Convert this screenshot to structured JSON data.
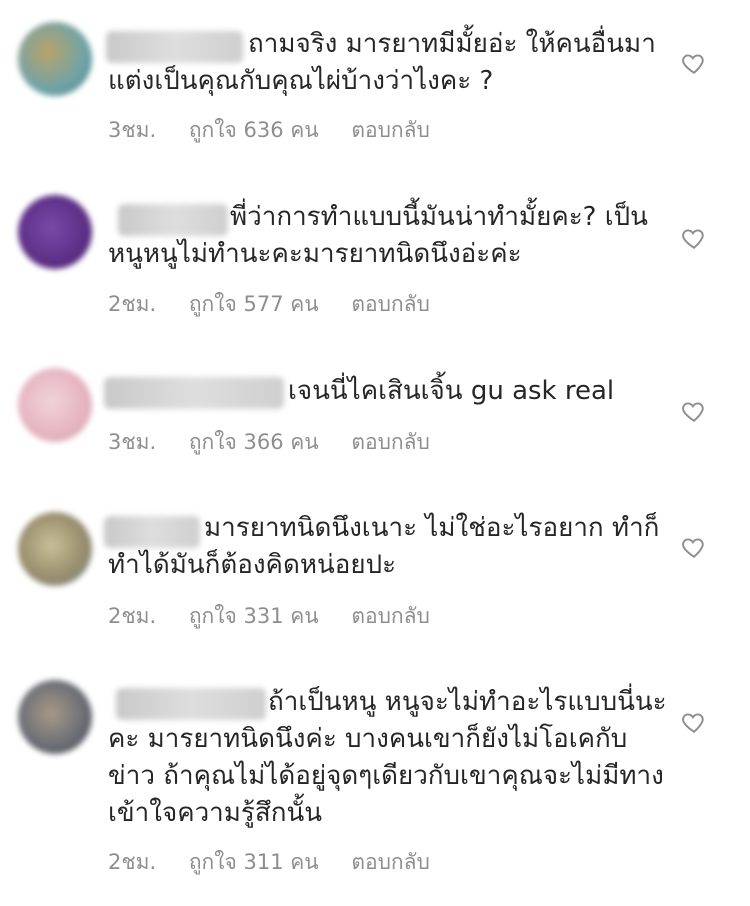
{
  "comments": [
    {
      "text": "ถามจริง มารยาทมีมั้ยอ่ะ ให้คนอื่นมาแต่งเป็นคุณกับคุณไผ่บ้างว่าไงคะ ?",
      "time": "3ชม.",
      "likes": "ถูกใจ 636 คน",
      "reply": "ตอบกลับ",
      "avatar_color": "#6fa3a8"
    },
    {
      "text": "พี่ว่าการทำแบบนี้มันน่าทำมั้ยคะ? เป็นหนูหนูไม่ทำนะคะมารยาทนิดนึงอ่ะค่ะ",
      "time": "2ชม.",
      "likes": "ถูกใจ 577 คน",
      "reply": "ตอบกลับ",
      "avatar_color": "#5c2f86"
    },
    {
      "text": "เจนนี่ไคเสินเจิ้น gu ask real",
      "time": "3ชม.",
      "likes": "ถูกใจ 366 คน",
      "reply": "ตอบกลับ",
      "avatar_color": "#e6b6c2"
    },
    {
      "text": "มารยาทนิดนึงเนาะ ไม่ใช่อะไรอยาก ทำก็ทำได้มันก็ต้องคิดหน่อยปะ",
      "time": "2ชม.",
      "likes": "ถูกใจ 331 คน",
      "reply": "ตอบกลับ",
      "avatar_color": "#9a8f6e"
    },
    {
      "text": "ถ้าเป็นหนู หนูจะไม่ทำอะไรแบบนี่นะคะ มารยาทนิดนึงค่ะ บางคนเขาก็ยังไม่โอเคกับข่าว ถ้าคุณไม่ได้อยู่จุดๆเดียวกับเขาคุณจะไม่มีทางเข้าใจความรู้สึกนั้น",
      "time": "2ชม.",
      "likes": "ถูกใจ 311 คน",
      "reply": "ตอบกลับ",
      "avatar_color": "#6e7077"
    }
  ]
}
